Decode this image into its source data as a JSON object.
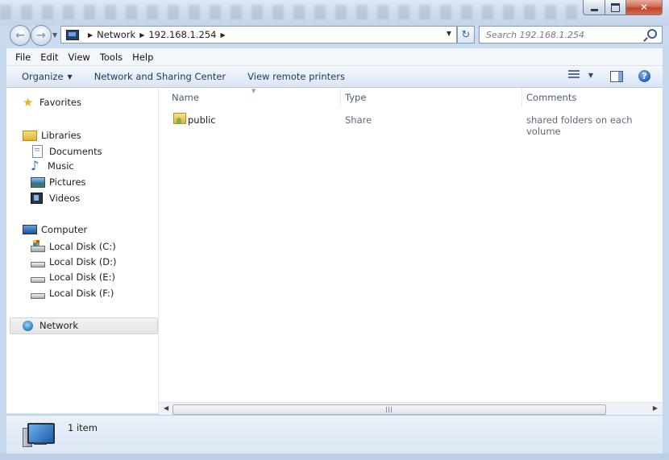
{
  "address": {
    "crumbs": [
      "Network",
      "192.168.1.254"
    ]
  },
  "search": {
    "placeholder": "Search 192.168.1.254"
  },
  "menu": [
    "File",
    "Edit",
    "View",
    "Tools",
    "Help"
  ],
  "toolbar": {
    "organize": "Organize",
    "network_sharing": "Network and Sharing Center",
    "view_printers": "View remote printers"
  },
  "nav": {
    "favorites": "Favorites",
    "libraries": "Libraries",
    "documents": "Documents",
    "music": "Music",
    "pictures": "Pictures",
    "videos": "Videos",
    "computer": "Computer",
    "disk_c": "Local Disk (C:)",
    "disk_d": "Local Disk (D:)",
    "disk_e": "Local Disk (E:)",
    "disk_f": "Local Disk (F:)",
    "network": "Network"
  },
  "columns": [
    "Name",
    "Type",
    "Comments"
  ],
  "files": [
    {
      "name": "public",
      "type": "Share",
      "comment": "shared folders on each volume"
    }
  ],
  "details": {
    "item_count": "1 item"
  }
}
